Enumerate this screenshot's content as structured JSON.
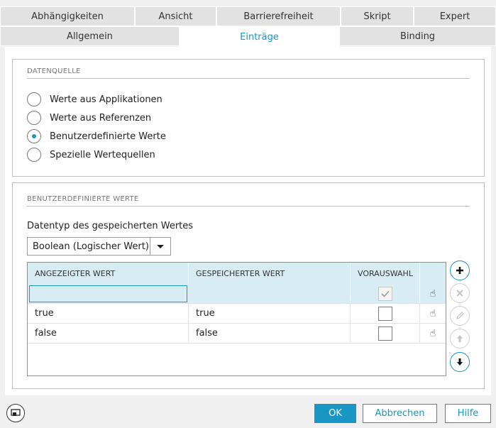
{
  "tabs_row1": [
    {
      "label": "Abhängigkeiten"
    },
    {
      "label": "Ansicht"
    },
    {
      "label": "Barrierefreiheit"
    },
    {
      "label": "Skript"
    },
    {
      "label": "Expert"
    }
  ],
  "tabs_row2": [
    {
      "label": "Allgemein"
    },
    {
      "label": "Einträge",
      "active": true
    },
    {
      "label": "Binding"
    }
  ],
  "datenquelle": {
    "title": "DATENQUELLE",
    "options": [
      {
        "label": "Werte aus Applikationen",
        "checked": false
      },
      {
        "label": "Werte aus Referenzen",
        "checked": false
      },
      {
        "label": "Benutzerdefinierte Werte",
        "checked": true
      },
      {
        "label": "Spezielle Wertequellen",
        "checked": false
      }
    ]
  },
  "benutzer": {
    "title": "BENUTZERDEFINIERTE WERTE",
    "datatype_label": "Datentyp des gespeicherten Wertes",
    "datatype_value": "Boolean (Logischer Wert)",
    "columns": [
      "ANGEZEIGTER WERT",
      "GESPEICHERTER WERT",
      "VORAUSWAHL"
    ],
    "rows": [
      {
        "displayed": "",
        "stored": "",
        "preselected": true,
        "editing": true
      },
      {
        "displayed": "true",
        "stored": "true",
        "preselected": false
      },
      {
        "displayed": "false",
        "stored": "false",
        "preselected": false
      }
    ]
  },
  "buttons": {
    "ok": "OK",
    "cancel": "Abbrechen",
    "help": "Hilfe"
  },
  "colors": {
    "accent": "#1a96c4",
    "header_bg": "#d7ecf3"
  }
}
